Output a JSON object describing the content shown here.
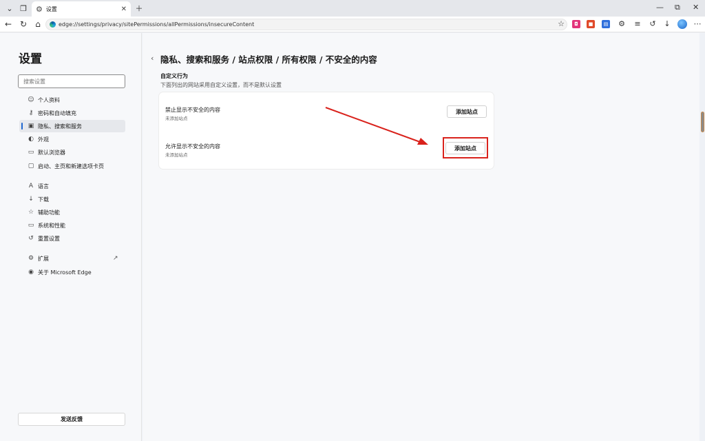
{
  "tab": {
    "title": "设置"
  },
  "address_bar": {
    "url": "edge://settings/privacy/sitePermissions/allPermissions/insecureContent"
  },
  "sidebar": {
    "title": "设置",
    "search_placeholder": "搜索设置",
    "items": [
      {
        "label": "个人资料",
        "icon": "profile-icon",
        "glyph": "☺"
      },
      {
        "label": "密码和自动填充",
        "icon": "key-icon",
        "glyph": "⚷"
      },
      {
        "label": "隐私、搜索和服务",
        "icon": "lock-icon",
        "glyph": "🔒"
      },
      {
        "label": "外观",
        "icon": "appearance-icon",
        "glyph": "◐"
      },
      {
        "label": "默认浏览器",
        "icon": "browser-icon",
        "glyph": "▭"
      },
      {
        "label": "启动、主页和新建选项卡页",
        "icon": "home-tabs-icon",
        "glyph": "▢"
      },
      {
        "label": "语言",
        "icon": "language-icon",
        "glyph": "A"
      },
      {
        "label": "下载",
        "icon": "download-icon",
        "glyph": "↓"
      },
      {
        "label": "辅助功能",
        "icon": "accessibility-icon",
        "glyph": "☆"
      },
      {
        "label": "系统和性能",
        "icon": "system-icon",
        "glyph": "▭"
      },
      {
        "label": "重置设置",
        "icon": "reset-icon",
        "glyph": "↺"
      },
      {
        "label": "扩展",
        "icon": "extensions-icon",
        "glyph": "⚙"
      },
      {
        "label": "关于 Microsoft Edge",
        "icon": "edge-icon",
        "glyph": "◉"
      }
    ],
    "feedback_label": "发送反馈"
  },
  "main": {
    "breadcrumb": "隐私、搜索和服务 / 站点权限 / 所有权限 / 不安全的内容",
    "section_title": "自定义行为",
    "section_subtitle": "下面列出的网站采用自定义设置，而不是默认设置",
    "rows": [
      {
        "title": "禁止显示不安全的内容",
        "subtitle": "未添加站点",
        "button": "添加站点"
      },
      {
        "title": "允许显示不安全的内容",
        "subtitle": "未添加站点",
        "button": "添加站点"
      }
    ]
  },
  "colors": {
    "annotation": "#d9221c",
    "accent": "#1e66d0"
  }
}
